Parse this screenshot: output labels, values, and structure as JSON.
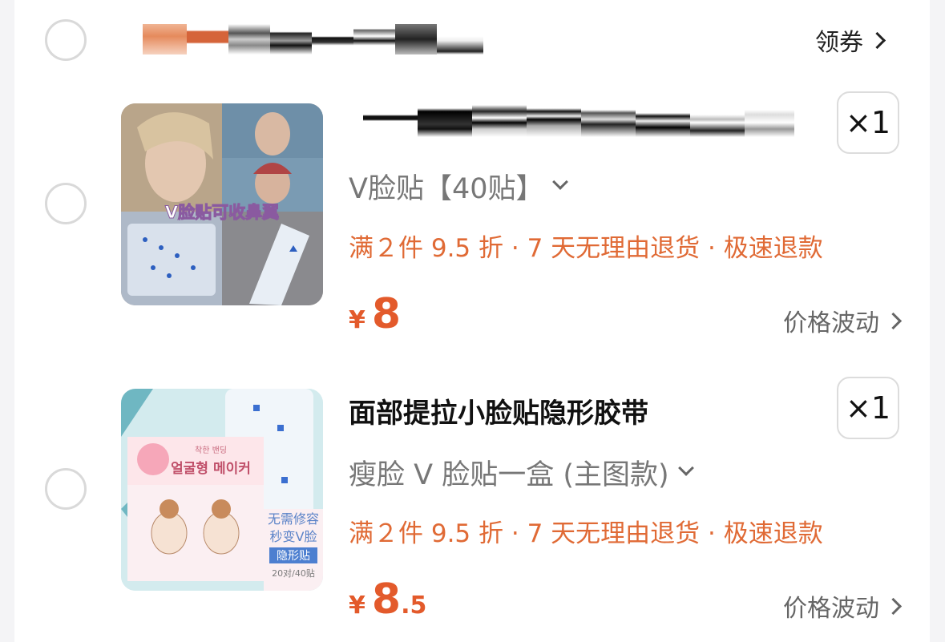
{
  "shop": {
    "coupon_label": "领券",
    "name_censored_colors": [
      "#e58a5c",
      "#d5643a",
      "#8a8a8a",
      "#1f1f1f",
      "#3a3a3a",
      "#111",
      "#777",
      "#222",
      "#bbb"
    ]
  },
  "items": [
    {
      "variant": "V脸贴【40贴】",
      "promo": "满２件 9.5 折 · 7 天无理由退货 · 极速退款",
      "price_currency": "¥",
      "price_int": "8",
      "price_dec": "",
      "quantity": "×1",
      "price_note": "价格波动",
      "image_caption": "V脸贴可收鼻翼"
    },
    {
      "title": "面部提拉小脸贴隐形胶带",
      "variant": "瘦脸 V 脸贴一盒 (主图款)",
      "promo": "满２件 9.5 折 · 7 天无理由退货 · 极速退款",
      "price_currency": "¥",
      "price_int": "8",
      "price_dec": ".5",
      "quantity": "×1",
      "price_note": "价格波动",
      "image_text": {
        "korean_1": "얼굴형 메이커",
        "line1": "无需修容",
        "line2": "秒变V脸",
        "tag": "隐形贴",
        "count": "20对/40贴"
      }
    }
  ]
}
